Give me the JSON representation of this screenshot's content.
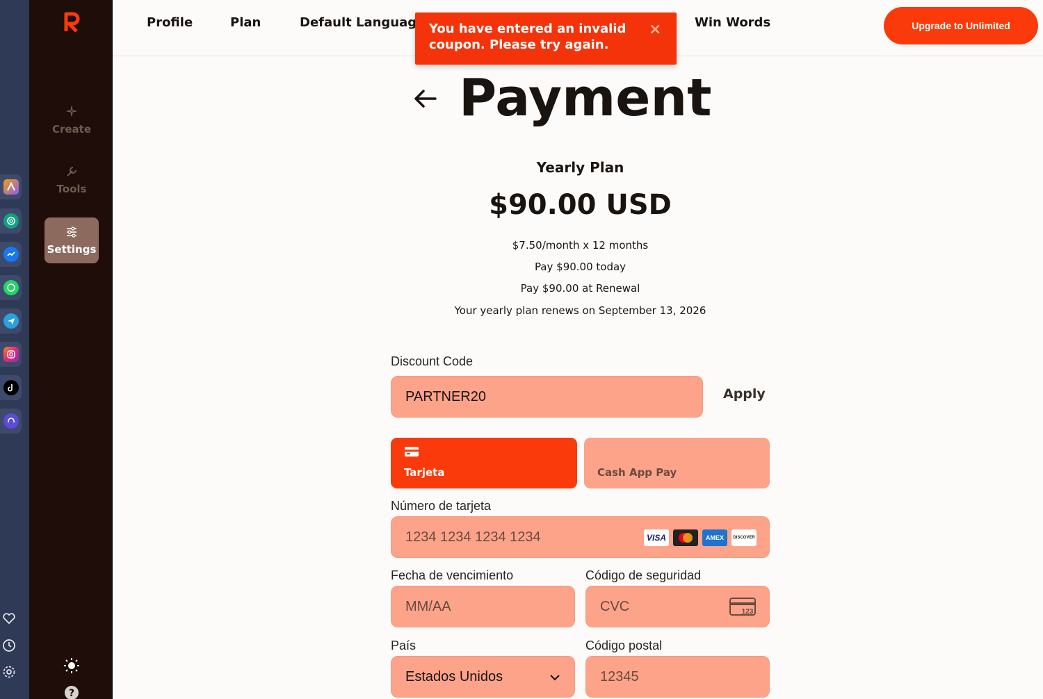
{
  "dock": {
    "apps": [
      "app-a-icon",
      "chatgpt-icon",
      "messenger-icon",
      "whatsapp-icon",
      "telegram-icon",
      "instagram-icon",
      "tiktok-icon",
      "headset-icon"
    ],
    "bottom": [
      "heart-icon",
      "clock-icon",
      "gear-icon"
    ]
  },
  "nav": {
    "items": [
      {
        "label": "Create",
        "icon": "sparkles-icon"
      },
      {
        "label": "Tools",
        "icon": "wrench-icon"
      },
      {
        "label": "Settings",
        "icon": "sliders-icon",
        "active": true
      }
    ],
    "bottom": [
      "sun-icon",
      "help-icon"
    ]
  },
  "topbar": {
    "tabs": [
      "Profile",
      "Plan",
      "Default Language",
      "Win Words"
    ],
    "upgrade_label": "Upgrade to Unlimited"
  },
  "toast": {
    "message": "You have entered an invalid coupon. Please try again.",
    "close": "×"
  },
  "payment": {
    "title": "Payment",
    "plan_name": "Yearly Plan",
    "price": "$90.00 USD",
    "details": [
      "$7.50/month x 12 months",
      "Pay $90.00 today",
      "Pay $90.00 at Renewal",
      "Your yearly plan renews on September 13, 2026"
    ],
    "discount": {
      "label": "Discount Code",
      "value": "PARTNER20",
      "apply_label": "Apply"
    },
    "methods": [
      {
        "label": "Tarjeta",
        "active": true
      },
      {
        "label": "Cash App Pay",
        "active": false
      }
    ],
    "card_number": {
      "label": "Número de tarjeta",
      "placeholder": "1234 1234 1234 1234"
    },
    "card_brands": [
      "VISA",
      "MC",
      "AMEX",
      "DISCOVER"
    ],
    "expiry": {
      "label": "Fecha de vencimiento",
      "placeholder": "MM/AA"
    },
    "cvc": {
      "label": "Código de seguridad",
      "placeholder": "CVC",
      "badge": "123"
    },
    "country": {
      "label": "País",
      "value": "Estados Unidos"
    },
    "postal": {
      "label": "Código postal",
      "placeholder": "12345"
    }
  },
  "colors": {
    "accent": "#fa3a0a",
    "field_bg": "#fca38a",
    "sidebar_bg": "#1e0d08",
    "dock_bg": "#2f3a56"
  }
}
